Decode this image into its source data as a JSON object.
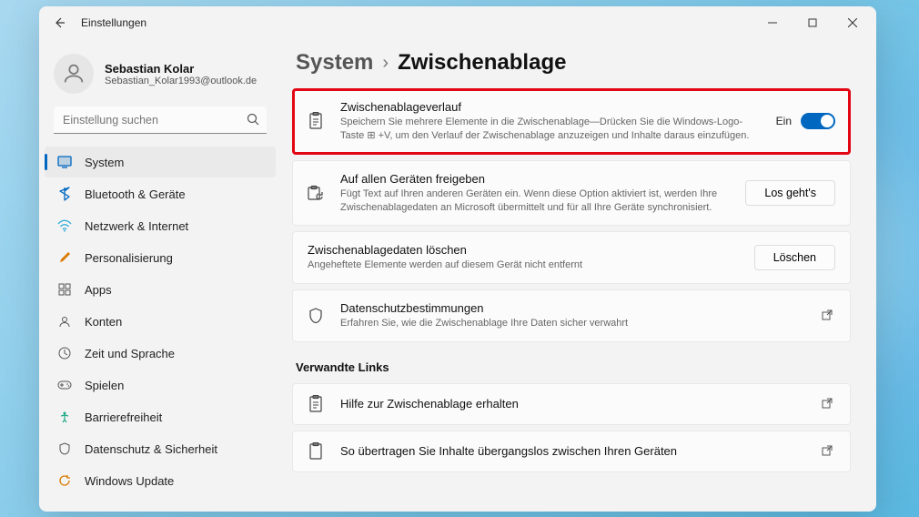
{
  "app": {
    "title": "Einstellungen"
  },
  "user": {
    "name": "Sebastian Kolar",
    "email": "Sebastian_Kolar1993@outlook.de"
  },
  "search": {
    "placeholder": "Einstellung suchen"
  },
  "nav": {
    "items": [
      {
        "label": "System",
        "active": true
      },
      {
        "label": "Bluetooth & Geräte"
      },
      {
        "label": "Netzwerk & Internet"
      },
      {
        "label": "Personalisierung"
      },
      {
        "label": "Apps"
      },
      {
        "label": "Konten"
      },
      {
        "label": "Zeit und Sprache"
      },
      {
        "label": "Spielen"
      },
      {
        "label": "Barrierefreiheit"
      },
      {
        "label": "Datenschutz & Sicherheit"
      },
      {
        "label": "Windows Update"
      }
    ]
  },
  "breadcrumb": {
    "parent": "System",
    "current": "Zwischenablage"
  },
  "cards": {
    "history": {
      "title": "Zwischenablageverlauf",
      "desc": "Speichern Sie mehrere Elemente in die Zwischenablage—Drücken Sie die Windows-Logo-Taste ⊞ +V, um den Verlauf der Zwischenablage anzuzeigen und Inhalte daraus einzufügen.",
      "toggle_label": "Ein"
    },
    "sync": {
      "title": "Auf allen Geräten freigeben",
      "desc": "Fügt Text auf Ihren anderen Geräten ein. Wenn diese Option aktiviert ist, werden Ihre Zwischenablagedaten an Microsoft übermittelt und für all Ihre Geräte synchronisiert.",
      "button": "Los geht's"
    },
    "clear": {
      "title": "Zwischenablagedaten löschen",
      "desc": "Angeheftete Elemente werden auf diesem Gerät nicht entfernt",
      "button": "Löschen"
    },
    "privacy": {
      "title": "Datenschutzbestimmungen",
      "desc": "Erfahren Sie, wie die Zwischenablage Ihre Daten sicher verwahrt"
    }
  },
  "related": {
    "heading": "Verwandte Links",
    "help": {
      "title": "Hilfe zur Zwischenablage erhalten"
    },
    "transfer": {
      "title": "So übertragen Sie Inhalte übergangslos zwischen Ihren Geräten"
    }
  }
}
